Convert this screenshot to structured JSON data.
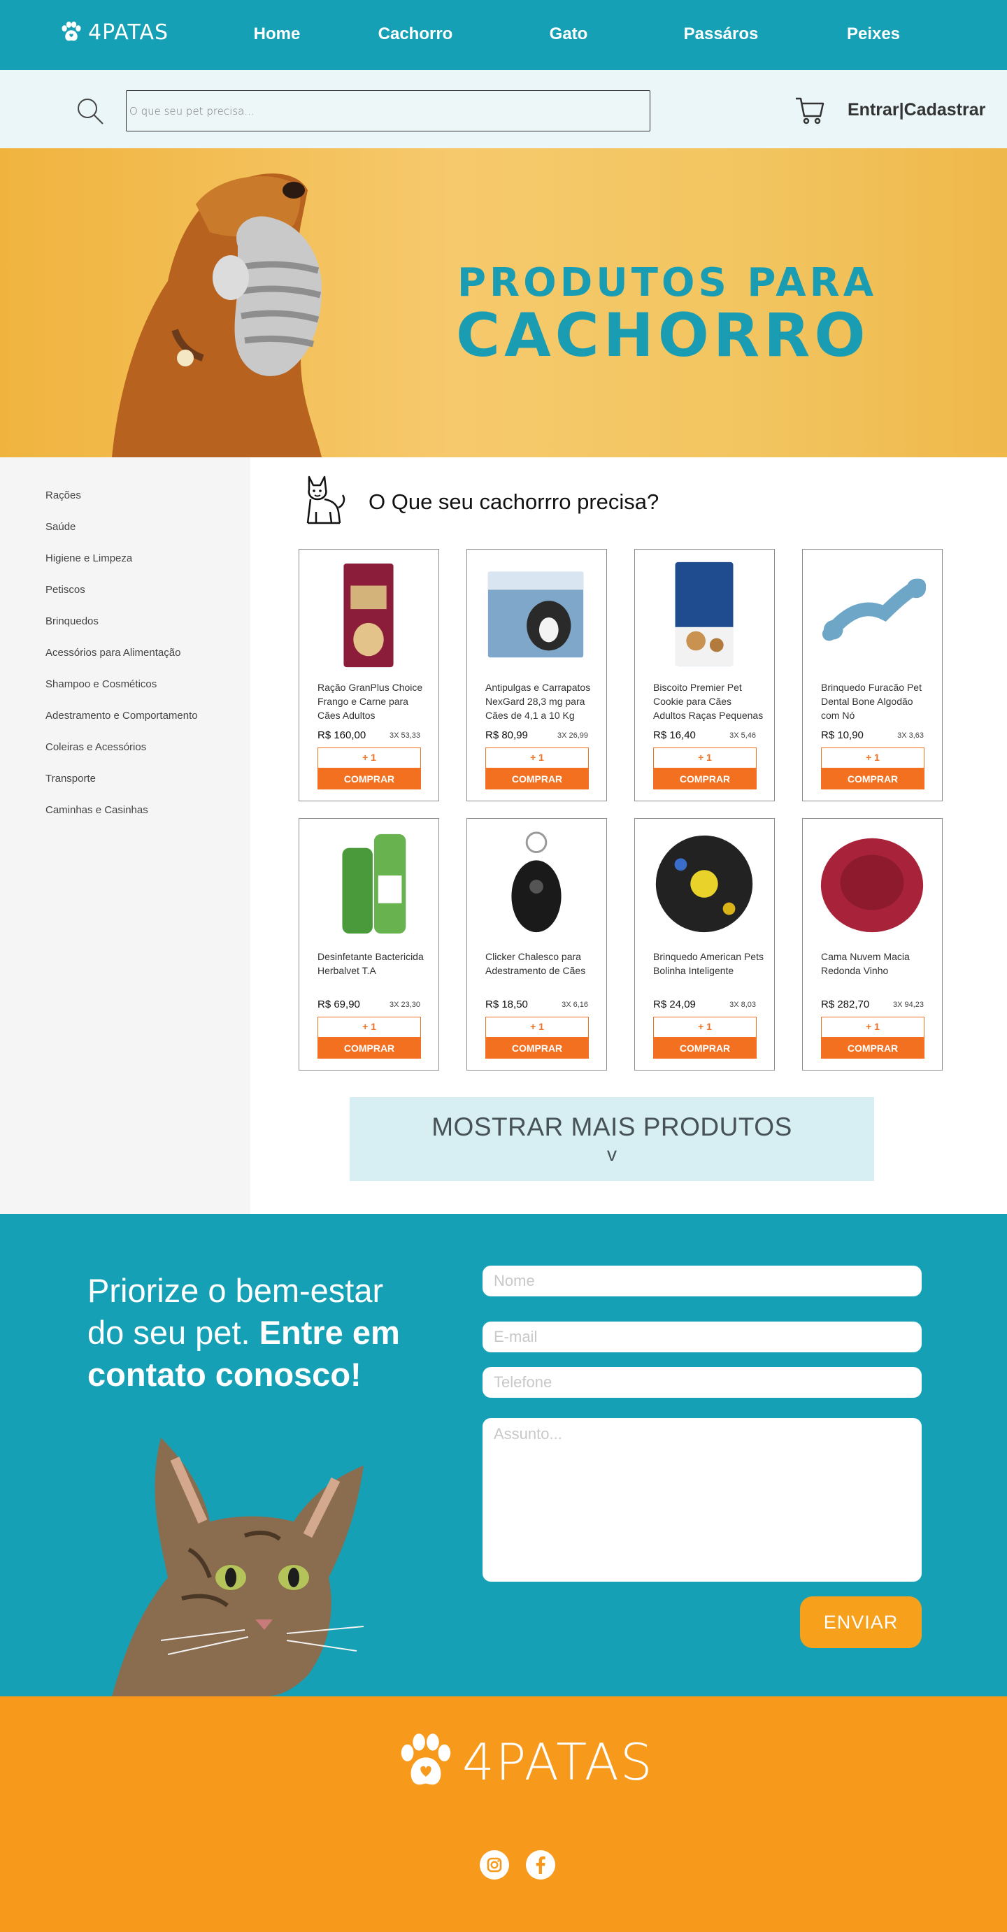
{
  "brand": {
    "name": "4PATAS"
  },
  "nav": {
    "items": [
      "Home",
      "Cachorro",
      "Gato",
      "Passáros",
      "Peixes"
    ]
  },
  "search": {
    "placeholder": "O que seu pet precisa...",
    "auth": "Entrar|Cadastrar"
  },
  "hero": {
    "line1": "PRODUTOS PARA",
    "line2": "CACHORRO"
  },
  "sidebar": {
    "items": [
      "Rações",
      "Saúde",
      "Higiene e Limpeza",
      "Petiscos",
      "Brinquedos",
      "Acessórios para Alimentação",
      "Shampoo e Cosméticos",
      "Adestramento e Comportamento",
      "Coleiras e Acessórios",
      "Transporte",
      "Caminhas e Casinhas"
    ]
  },
  "main": {
    "title": "O Que seu cachorrro precisa?"
  },
  "products": [
    {
      "name": "Ração GranPlus Choice Frango e Carne para Cães Adultos",
      "price": "R$ 160,00",
      "installments": "3X 53,33",
      "plus": "+ 1",
      "buy": "COMPRAR",
      "img_color": "#8b1d3a"
    },
    {
      "name": "Antipulgas e Carrapatos NexGard 28,3 mg para Cães de 4,1 a 10 Kg",
      "price": "R$ 80,99",
      "installments": "3X 26,99",
      "plus": "+ 1",
      "buy": "COMPRAR",
      "img_color": "#7fa7c9"
    },
    {
      "name": "Biscoito Premier Pet Cookie para Cães Adultos Raças Pequenas",
      "price": "R$ 16,40",
      "installments": "3X 5,46",
      "plus": "+ 1",
      "buy": "COMPRAR",
      "img_color": "#1e4c8f"
    },
    {
      "name": "Brinquedo Furacão Pet Dental Bone Algodão com Nó",
      "price": "R$ 10,90",
      "installments": "3X 3,63",
      "plus": "+ 1",
      "buy": "COMPRAR",
      "img_color": "#6ea6c7"
    },
    {
      "name": "Desinfetante Bactericida Herbalvet T.A",
      "price": "R$ 69,90",
      "installments": "3X 23,30",
      "plus": "+ 1",
      "buy": "COMPRAR",
      "img_color": "#4a9a3c"
    },
    {
      "name": "Clicker Chalesco para Adestramento de Cães",
      "price": "R$ 18,50",
      "installments": "3X 6,16",
      "plus": "+ 1",
      "buy": "COMPRAR",
      "img_color": "#1a1a1a"
    },
    {
      "name": "Brinquedo American Pets Bolinha Inteligente",
      "price": "R$ 24,09",
      "installments": "3X 8,03",
      "plus": "+ 1",
      "buy": "COMPRAR",
      "img_color": "#222222"
    },
    {
      "name": "Cama Nuvem Macia Redonda Vinho",
      "price": "R$ 282,70",
      "installments": "3X 94,23",
      "plus": "+ 1",
      "buy": "COMPRAR",
      "img_color": "#a8233a"
    }
  ],
  "more": {
    "label": "MOSTRAR MAIS PRODUTOS",
    "chevron": "v"
  },
  "contact": {
    "text_plain": "Priorize o bem-estar do seu pet.",
    "text_bold": "Entre em contato conosco!",
    "name_placeholder": "Nome",
    "email_placeholder": "E-mail",
    "phone_placeholder": "Telefone",
    "subject_placeholder": "Assunto...",
    "send": "ENVIAR"
  },
  "colors": {
    "teal": "#16a0b5",
    "orange": "#f37021",
    "footer_orange": "#f79a1c",
    "hero_yellow": "#f2c560"
  },
  "social": [
    "instagram-icon",
    "facebook-icon"
  ]
}
